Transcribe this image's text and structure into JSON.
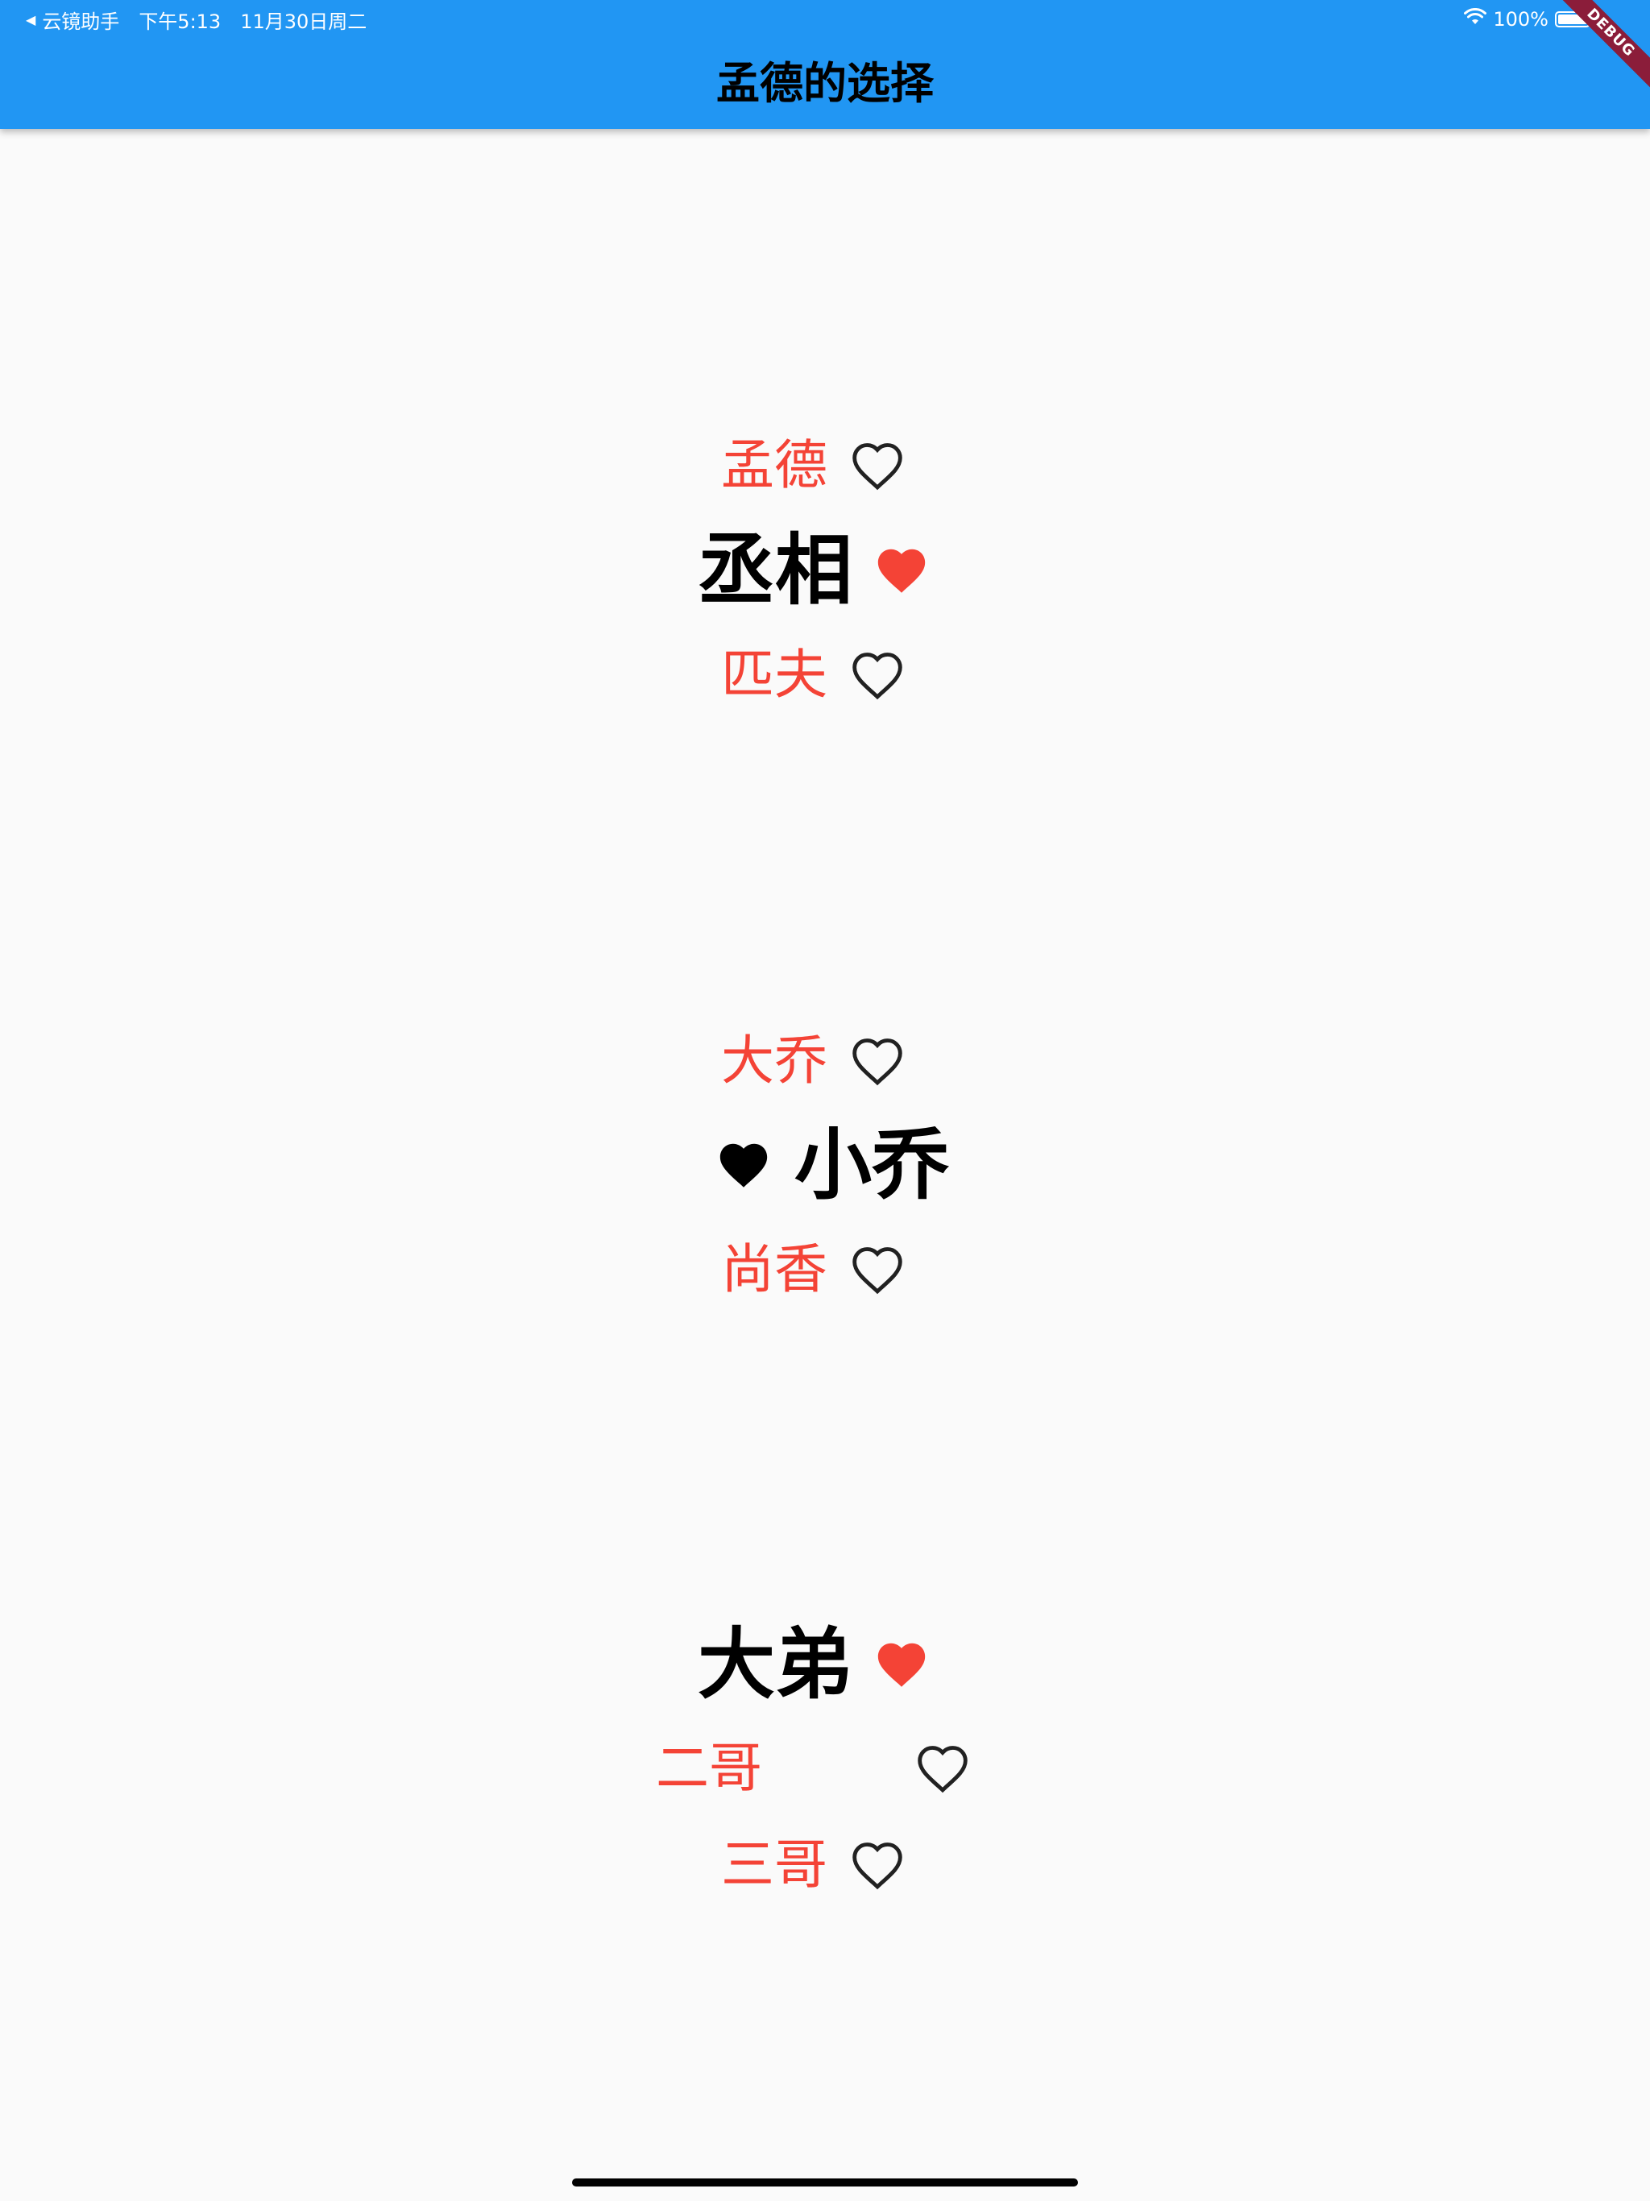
{
  "status_bar": {
    "back_app": "云镜助手",
    "time": "下午5:13",
    "date": "11月30日周二",
    "battery": "100%"
  },
  "app_bar": {
    "title": "孟德的选择",
    "debug_banner": "DEBUG"
  },
  "groups": [
    {
      "items": [
        {
          "label": "孟德",
          "selected": false
        },
        {
          "label": "丞相",
          "selected": true
        },
        {
          "label": "匹夫",
          "selected": false
        }
      ]
    },
    {
      "items": [
        {
          "label": "大乔",
          "selected": false
        },
        {
          "label": "小乔",
          "selected": true
        },
        {
          "label": "尚香",
          "selected": false
        }
      ]
    },
    {
      "items": [
        {
          "label": "大弟",
          "selected": true
        },
        {
          "label": "二哥",
          "selected": false
        },
        {
          "label": "三哥",
          "selected": false
        }
      ]
    }
  ],
  "colors": {
    "app_bar": "#2196f3",
    "accent_red": "#f44336",
    "background": "#fafafa"
  },
  "icons": {
    "outline": "heart-outline-icon",
    "filled": "heart-filled-icon"
  }
}
